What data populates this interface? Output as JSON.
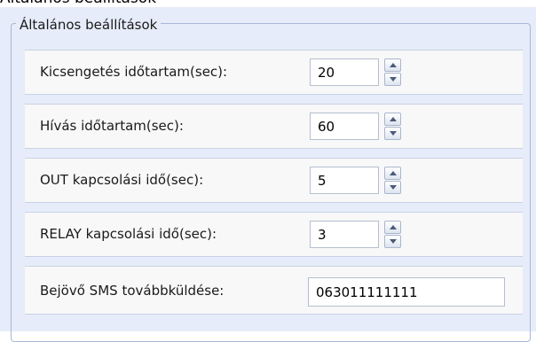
{
  "window": {
    "title": "Általános beállítások"
  },
  "group": {
    "legend": "Általános beállítások",
    "rows": [
      {
        "label": "Kicsengetés időtartam(sec):",
        "value": "20"
      },
      {
        "label": "Hívás időtartam(sec):",
        "value": "60"
      },
      {
        "label": "OUT kapcsolási idő(sec):",
        "value": "5"
      },
      {
        "label": "RELAY kapcsolási idő(sec):",
        "value": "3"
      },
      {
        "label": "Bejövő SMS továbbküldése:",
        "value": "063011111111"
      }
    ]
  },
  "icons": {
    "spin_up": "chevron-up-icon",
    "spin_down": "chevron-down-icon"
  },
  "colors": {
    "panel_background": "#e6ecf9",
    "row_background": "#f8f8f8",
    "border": "#a8b8d6"
  }
}
